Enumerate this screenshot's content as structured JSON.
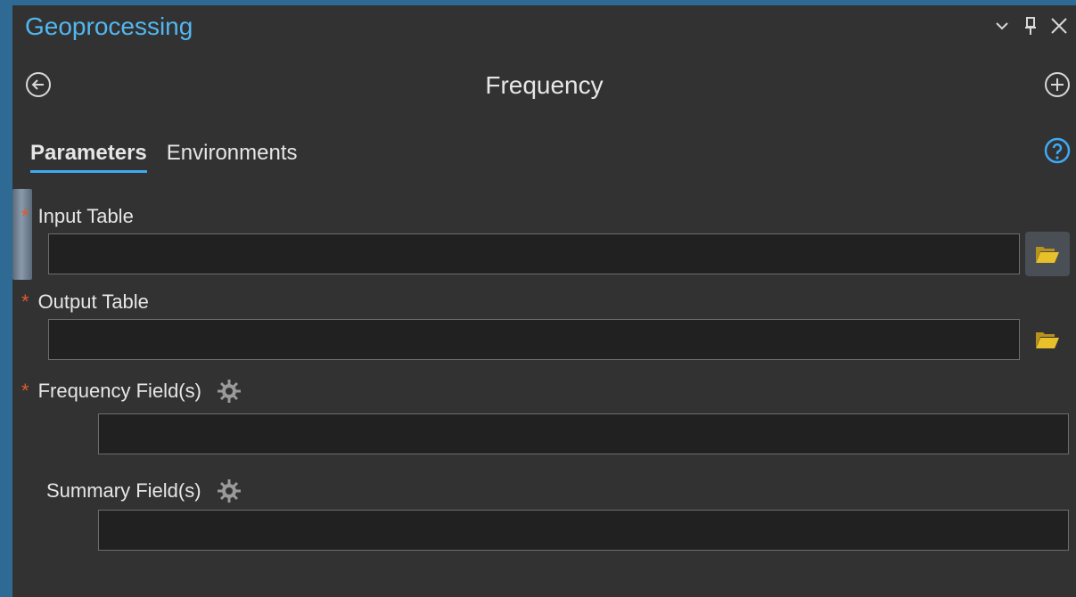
{
  "pane": {
    "title": "Geoprocessing",
    "controls": [
      "chevron-down-icon",
      "pin-icon",
      "close-icon"
    ]
  },
  "tool": {
    "title": "Frequency"
  },
  "tabs": [
    {
      "label": "Parameters",
      "active": true
    },
    {
      "label": "Environments",
      "active": false
    }
  ],
  "parameters": {
    "input_table": {
      "label": "Input Table",
      "required": true,
      "value": ""
    },
    "output_table": {
      "label": "Output Table",
      "required": true,
      "value": ""
    },
    "frequency_fields": {
      "label": "Frequency Field(s)",
      "required": true,
      "value": ""
    },
    "summary_fields": {
      "label": "Summary Field(s)",
      "required": false,
      "value": ""
    }
  },
  "required_marker": "*",
  "colors": {
    "accent": "#52b7f0",
    "required": "#e05a2a",
    "pane_bg": "#323232",
    "field_bg": "#212121",
    "folder": "#e8c02a"
  }
}
